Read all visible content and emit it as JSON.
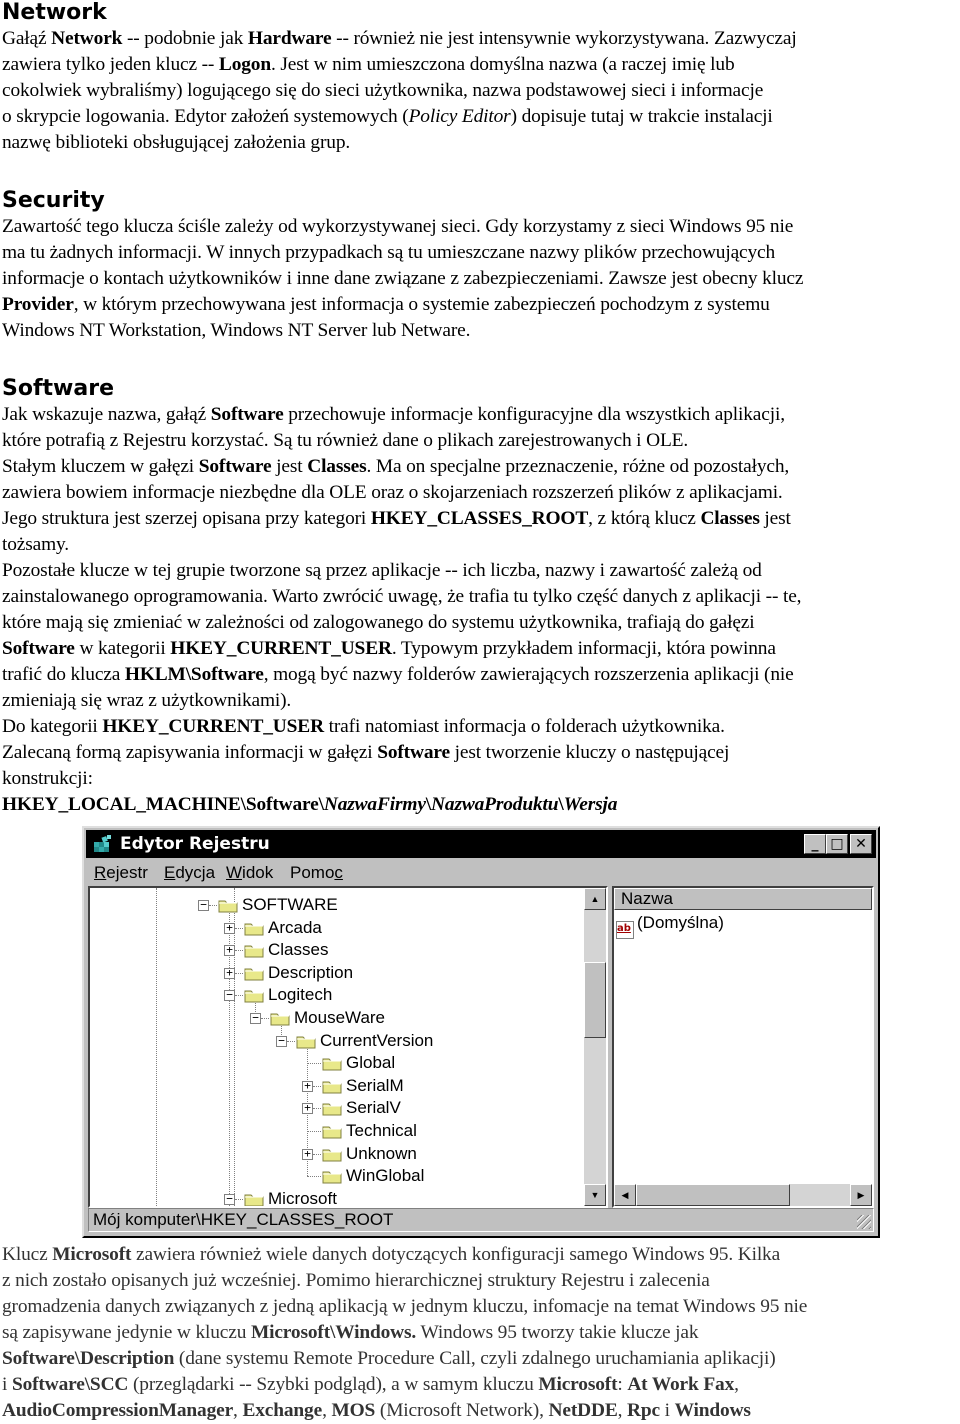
{
  "sections": {
    "network": {
      "heading": "Network",
      "lines": [
        [
          "Gałąź ",
          {
            "b": "Network"
          },
          " -- podobnie jak ",
          {
            "b": "Hardware"
          },
          " -- również nie jest intensywnie wykorzystywana. Zazwyczaj"
        ],
        [
          "zawiera tylko jeden klucz -- ",
          {
            "b": "Logon"
          },
          ". Jest w nim umieszczona domyślna nazwa (a raczej imię lub"
        ],
        [
          "cokolwiek wybraliśmy) logującego się do sieci użytkownika, nazwa podstawowej sieci i informacje"
        ],
        [
          "o skrypcie logowania. Edytor założeń systemowych (",
          {
            "i": "Policy Editor"
          },
          ") dopisuje tutaj w trakcie instalacji"
        ],
        [
          "nazwę biblioteki obsługującej założenia grup."
        ]
      ]
    },
    "security": {
      "heading": "Security",
      "lines": [
        [
          "Zawartość tego klucza ściśle zależy od wykorzystywanej sieci. Gdy korzystamy z sieci Windows 95 nie"
        ],
        [
          "ma tu żadnych informacji. W innych przypadkach są tu umieszczane nazwy plików przechowujących"
        ],
        [
          "informacje o kontach użytkowników i inne dane związane z zabezpieczeniami. Zawsze jest obecny klucz"
        ],
        [
          {
            "b": "Provider"
          },
          ", w którym przechowywana jest informacja o systemie zabezpieczeń pochodzym z systemu"
        ],
        [
          "Windows NT Workstation, Windows NT Server lub Netware."
        ]
      ]
    },
    "software": {
      "heading": "Software",
      "lines": [
        [
          "Jak wskazuje nazwa, gałąź ",
          {
            "b": "Software"
          },
          " przechowuje informacje konfiguracyjne dla wszystkich aplikacji,"
        ],
        [
          "które potrafią z Rejestru korzystać. Są tu również dane o plikach zarejestrowanych i OLE."
        ],
        [
          "Stałym kluczem w gałęzi ",
          {
            "b": "Software"
          },
          " jest ",
          {
            "b": "Classes"
          },
          ". Ma on specjalne przeznaczenie, różne od pozostałych,"
        ],
        [
          "zawiera bowiem informacje niezbędne dla OLE oraz o skojarzeniach rozszerzeń plików z aplikacjami."
        ],
        [
          "Jego struktura jest szerzej opisana przy kategori ",
          {
            "b": "HKEY_CLASSES_ROOT"
          },
          ", z którą klucz ",
          {
            "b": "Classes"
          },
          " jest"
        ],
        [
          "tożsamy."
        ],
        [
          "Pozostałe klucze w tej grupie tworzone są przez aplikacje -- ich liczba, nazwy i zawartość zależą od"
        ],
        [
          "zainstalowanego oprogramowania. Warto zwrócić uwagę, że trafia tu tylko część danych z aplikacji -- te,"
        ],
        [
          "które mają się zmieniać w zależności od zalogowanego do systemu użytkownika, trafiają do gałęzi"
        ],
        [
          {
            "b": "Software"
          },
          " w kategorii ",
          {
            "b": "HKEY_CURRENT_USER"
          },
          ". Typowym przykładem informacji, która powinna"
        ],
        [
          "trafić do klucza ",
          {
            "b": "HKLM\\Software"
          },
          ", mogą być nazwy folderów zawierających rozszerzenia aplikacji (nie"
        ],
        [
          "zmieniają się wraz z użytkownikami)."
        ],
        [
          "Do kategorii ",
          {
            "b": "HKEY_CURRENT_USER"
          },
          " trafi natomiast informacja o folderach użytkownika."
        ],
        [
          "Zalecaną formą zapisywania informacji w gałęzi ",
          {
            "b": "Software"
          },
          " jest tworzenie kluczy o następującej"
        ],
        [
          "konstrukcji:"
        ],
        [
          {
            "b": "HKEY_LOCAL_MACHINE\\Software\\"
          },
          {
            "bi": "NazwaFirmy"
          },
          {
            "b": "\\"
          },
          {
            "bi": "NazwaProduktu"
          },
          {
            "b": "\\"
          },
          {
            "bi": "Wersja"
          }
        ]
      ]
    },
    "after": {
      "lines": [
        [
          "Klucz ",
          {
            "b": "Microsoft"
          },
          " zawiera również wiele danych dotyczących konfiguracji samego Windows 95. Kilka"
        ],
        [
          "z nich zostało opisanych już wcześniej. Pomimo hierarchicznej struktury Rejestru i zalecenia"
        ],
        [
          "gromadzenia danych związanych z jedną aplikacją w jednym kluczu, infomacje na temat Windows 95 nie"
        ],
        [
          "są zapisywane jedynie w kluczu ",
          {
            "b": "Microsoft\\Windows."
          },
          " Windows 95 tworzy takie klucze jak"
        ],
        [
          {
            "b": "Software\\Description"
          },
          " (dane systemu Remote Procedure Call, czyli zdalnego uruchamiania aplikacji)"
        ],
        [
          "i ",
          {
            "b": "Software\\SCC"
          },
          " (przeglądarki -- Szybki podgląd), a w samym kluczu ",
          {
            "b": "Microsoft"
          },
          ": ",
          {
            "b": "At Work Fax"
          },
          ","
        ],
        [
          {
            "b": "AudioCompressionManager"
          },
          ", ",
          {
            "b": "Exchange"
          },
          ", ",
          {
            "b": "MOS"
          },
          " (Microsoft Network), ",
          {
            "b": "NetDDE"
          },
          ", ",
          {
            "b": "Rpc"
          },
          " i ",
          {
            "b": "Windows"
          }
        ]
      ]
    }
  },
  "regedit": {
    "title": "Edytor Rejestru",
    "title_icon": "regedit-icon",
    "buttons": {
      "minimize": "_",
      "maximize": "□",
      "close": "✕"
    },
    "menu": [
      {
        "label": "Rejestr",
        "accel_index": 0
      },
      {
        "label": "Edycja",
        "accel_index": 0
      },
      {
        "label": "Widok",
        "accel_index": 0
      },
      {
        "label": "Pomoc",
        "accel_index": 4
      }
    ],
    "tree": [
      {
        "label": "SOFTWARE",
        "depth": 0,
        "expander": "minus"
      },
      {
        "label": "Arcada",
        "depth": 1,
        "expander": "plus"
      },
      {
        "label": "Classes",
        "depth": 1,
        "expander": "plus"
      },
      {
        "label": "Description",
        "depth": 1,
        "expander": "plus"
      },
      {
        "label": "Logitech",
        "depth": 1,
        "expander": "minus"
      },
      {
        "label": "MouseWare",
        "depth": 2,
        "expander": "minus"
      },
      {
        "label": "CurrentVersion",
        "depth": 3,
        "expander": "minus"
      },
      {
        "label": "Global",
        "depth": 4,
        "expander": "none"
      },
      {
        "label": "SerialM",
        "depth": 4,
        "expander": "plus"
      },
      {
        "label": "SerialV",
        "depth": 4,
        "expander": "plus"
      },
      {
        "label": "Technical",
        "depth": 4,
        "expander": "none"
      },
      {
        "label": "Unknown",
        "depth": 4,
        "expander": "plus"
      },
      {
        "label": "WinGlobal",
        "depth": 4,
        "expander": "none"
      },
      {
        "label": "Microsoft",
        "depth": 1,
        "expander": "minus"
      }
    ],
    "list": {
      "column": "Nazwa",
      "rows": [
        {
          "icon": "ab",
          "name": "(Domyślna)"
        }
      ]
    },
    "statusbar": "Mój komputer\\HKEY_CLASSES_ROOT"
  }
}
